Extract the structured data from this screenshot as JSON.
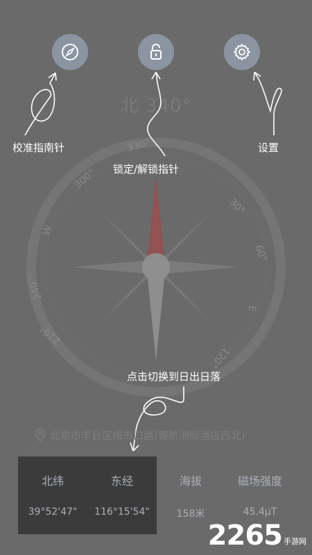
{
  "heading_ghost": "北 340°",
  "buttons": {
    "calibrate_icon": "compass-icon",
    "lock_icon": "unlock-icon",
    "settings_icon": "gear-icon"
  },
  "hints": {
    "calibrate": "校准指南针",
    "lock": "锁定/解锁指针",
    "settings": "设置",
    "switch": "点击切换到日出日落"
  },
  "compass": {
    "tick_labels": [
      "300°",
      "330°",
      "30°",
      "60°",
      "E",
      "120°",
      "210°",
      "240°",
      "W"
    ],
    "pointer_color": "#9b4a4a"
  },
  "location": "北京市丰台区梅市口路(寄航洲际酒店西北)",
  "data": [
    {
      "label": "北纬",
      "value": "39°52'47\""
    },
    {
      "label": "东经",
      "value": "116°15'54\""
    },
    {
      "label": "海拔",
      "value": "158米"
    },
    {
      "label": "磁场强度",
      "value": "45.4μT"
    }
  ],
  "watermark": {
    "main": "2265",
    "sub": "手游网"
  }
}
